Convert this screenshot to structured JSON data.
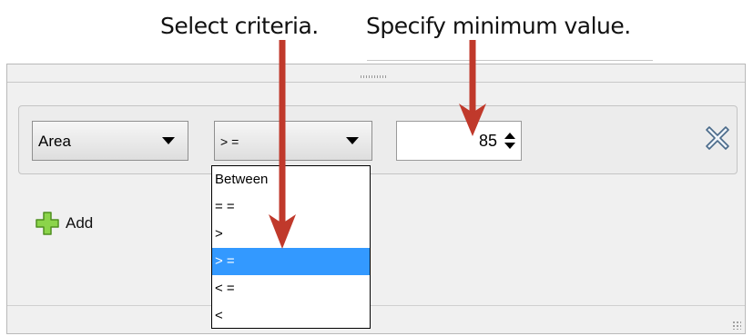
{
  "annotations": {
    "criteria": "Select criteria.",
    "minimum": "Specify minimum value."
  },
  "filter": {
    "attribute": "Area",
    "operator": ">=",
    "operator_display": "> =",
    "minimum_value": "85"
  },
  "operator_options": [
    {
      "label": "Between",
      "selected": false
    },
    {
      "label": "= =",
      "selected": false
    },
    {
      "label": ">",
      "selected": false
    },
    {
      "label": "> =",
      "selected": true
    },
    {
      "label": "< =",
      "selected": false
    },
    {
      "label": "<",
      "selected": false
    }
  ],
  "add_button": {
    "label": "Add",
    "icon": "plus-icon"
  },
  "remove_button": {
    "icon": "close-icon"
  },
  "colors": {
    "selection": "#3399ff",
    "annotation_arrow": "#c0392b",
    "plus_icon": "#7cc242"
  }
}
